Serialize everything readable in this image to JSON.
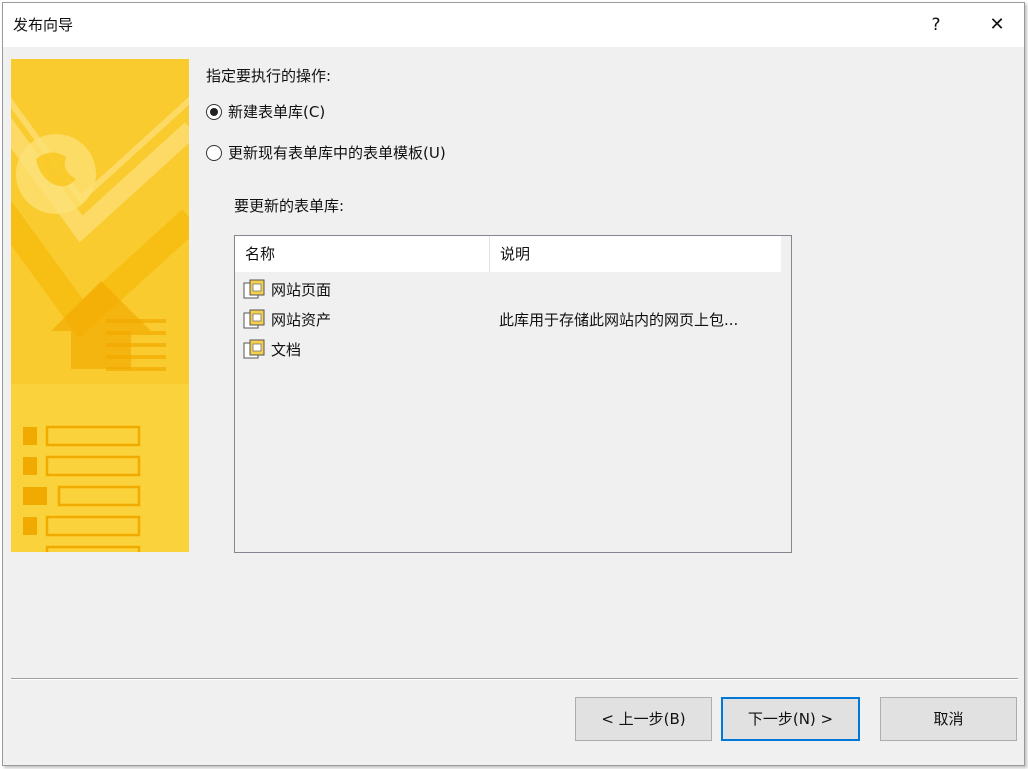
{
  "window": {
    "title": "发布向导",
    "help_label": "?",
    "close_label": "✕"
  },
  "content": {
    "prompt": "指定要执行的操作:",
    "options": [
      {
        "label": "新建表单库(C)",
        "selected": true
      },
      {
        "label": "更新现有表单库中的表单模板(U)",
        "selected": false
      }
    ],
    "list_caption": "要更新的表单库:"
  },
  "library_list": {
    "columns": [
      "名称",
      "说明"
    ],
    "rows": [
      {
        "name": "网站页面",
        "description": ""
      },
      {
        "name": "网站资产",
        "description": "此库用于存储此网站内的网页上包..."
      },
      {
        "name": "文档",
        "description": ""
      }
    ],
    "icon": "document-library-icon"
  },
  "buttons": {
    "back": "< 上一步(B)",
    "next": "下一步(N) >",
    "cancel": "取消"
  },
  "colors": {
    "banner": "#f8c61c",
    "accent": "#0078d7"
  }
}
